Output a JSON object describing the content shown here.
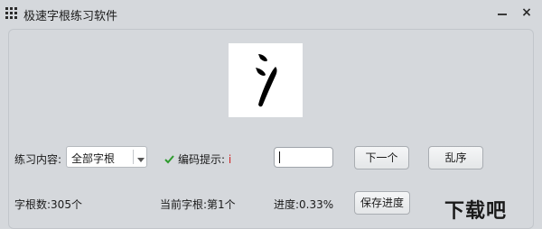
{
  "window": {
    "title": "极速字根练习软件",
    "close_glyph": "×",
    "icon": "grid-icon"
  },
  "display": {
    "glyph_icon": "zigen-water-radical-icon"
  },
  "controls": {
    "content_label": "练习内容:",
    "content_select_value": "全部字根",
    "hint_label": "编码提示:",
    "hint_value": "i",
    "answer_value": "",
    "next_button": "下一个",
    "shuffle_button": "乱序",
    "save_button": "保存进度"
  },
  "status": {
    "count": "字根数:305个",
    "current": "当前字根:第1个",
    "progress": "进度:0.33%"
  },
  "watermark": {
    "text": "下载吧"
  },
  "colors": {
    "background": "#d5d8dc",
    "hint_accent": "#d22222",
    "check_color": "#2e9b2e"
  }
}
